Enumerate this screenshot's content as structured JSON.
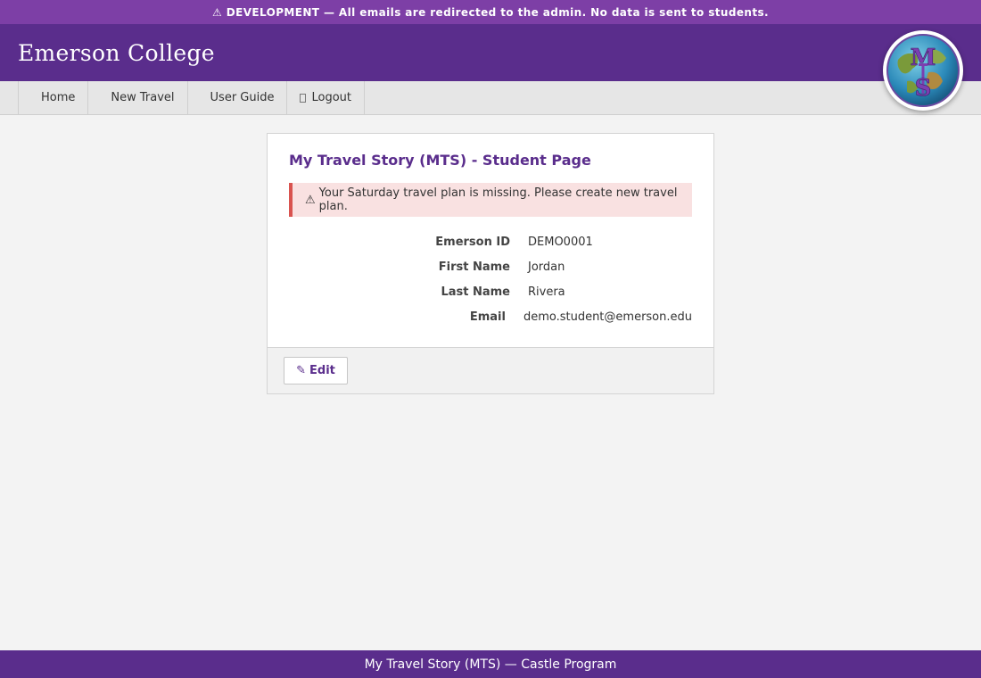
{
  "banner": {
    "icon": "warning-icon",
    "text": "⚠ DEVELOPMENT — All emails are redirected to the admin. No data is sent to students."
  },
  "header": {
    "brand": "Emerson College",
    "logo_icon": "mts-globe-logo",
    "logo_letters": "MTS"
  },
  "nav": {
    "items": [
      {
        "label": "Home"
      },
      {
        "label": "New Travel"
      },
      {
        "label": "User Guide"
      },
      {
        "label": "Logout",
        "icon": "logout-icon"
      }
    ]
  },
  "card": {
    "title": "My Travel Story (MTS) - Student Page",
    "alert": {
      "icon": "warning-icon",
      "warn_glyph": "⚠",
      "text": "Your Saturday travel plan is missing. Please create new travel plan."
    },
    "fields": [
      {
        "label": "Emerson ID",
        "value": "DEMO0001"
      },
      {
        "label": "First Name",
        "value": "Jordan"
      },
      {
        "label": "Last Name",
        "value": "Rivera"
      },
      {
        "label": "Email",
        "value": "demo.student@emerson.edu"
      }
    ],
    "edit_button": {
      "icon": "pencil-icon",
      "glyph": "✎",
      "label": "Edit"
    }
  },
  "footer": {
    "text": "My Travel Story (MTS) — Castle Program"
  },
  "colors": {
    "primary": "#5a2d8c",
    "banner": "#7d3fa6",
    "alert_bg": "#f9e1e1",
    "alert_border": "#d9534f",
    "page_bg": "#f3f3f3"
  }
}
